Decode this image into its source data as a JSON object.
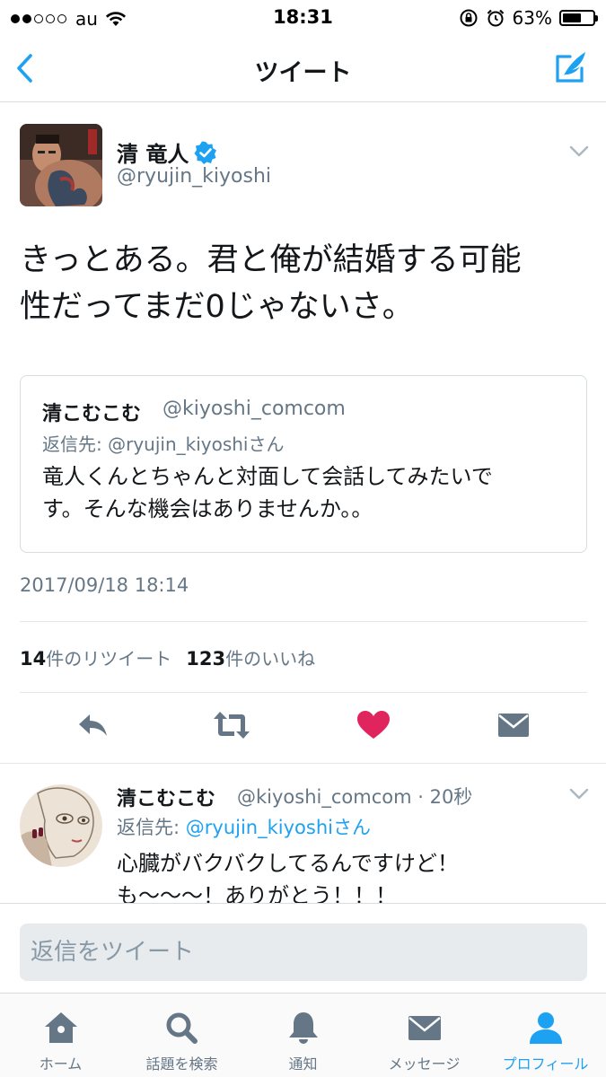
{
  "status_bar": {
    "carrier": "au",
    "time": "18:31",
    "battery_percent": "63%",
    "battery_level": 0.63,
    "signal_bars_filled": 2,
    "signal_bars_total": 5
  },
  "nav": {
    "title": "ツイート",
    "back_icon": "chevron-left-icon",
    "compose_icon": "compose-tweet-icon"
  },
  "tweet": {
    "author_name": "清 竜人",
    "author_handle": "@ryujin_kiyoshi",
    "verified": true,
    "text_line1": "きっとある。君と俺が結婚する可能",
    "text_line2": "性だってまだ0じゃないさ。",
    "timestamp": "2017/09/18 18:14",
    "retweet_count": "14",
    "retweet_label": "件のリツイート",
    "like_count": "123",
    "like_label": "件のいいね"
  },
  "quote": {
    "name": "清こむこむ",
    "handle": "@kiyoshi_comcom",
    "reply_to": "返信先: @ryujin_kiyoshiさん",
    "text_line1": "竜人くんとちゃんと対面して会話してみたいで",
    "text_line2": "す。そんな機会はありませんか。。"
  },
  "actions": [
    "reply-icon",
    "retweet-icon",
    "like-icon",
    "direct-message-icon"
  ],
  "reply": {
    "name": "清こむこむ",
    "meta": "@kiyoshi_comcom · 20秒",
    "reply_prefix": "返信先: ",
    "reply_link": "@ryujin_kiyoshiさん",
    "text_line1": "心臓がバクバクしてるんですけど！",
    "text_line2": "も〜〜〜！ありがとう！！！"
  },
  "composer": {
    "placeholder": "返信をツイート"
  },
  "colors": {
    "accent": "#1da1f2",
    "like": "#e0245e",
    "muted": "#657786",
    "text": "#14171a"
  },
  "tabs": [
    {
      "label": "ホーム",
      "icon": "home-icon"
    },
    {
      "label": "話題を検索",
      "icon": "search-icon"
    },
    {
      "label": "通知",
      "icon": "bell-icon"
    },
    {
      "label": "メッセージ",
      "icon": "envelope-icon"
    },
    {
      "label": "プロフィール",
      "icon": "profile-icon",
      "active": true
    }
  ]
}
